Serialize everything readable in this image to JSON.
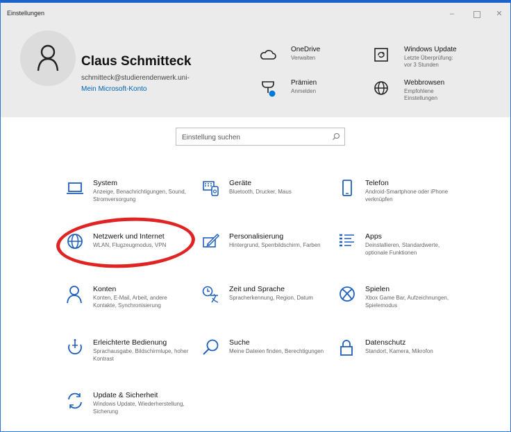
{
  "window": {
    "title": "Einstellungen",
    "controls": {
      "minimize": "–",
      "close": "✕"
    }
  },
  "account": {
    "name": "Claus Schmitteck",
    "email": "schmitteck@studierendenwerk.uni-",
    "link": "Mein Microsoft-Konto"
  },
  "header_items": [
    {
      "title": "OneDrive",
      "sub": [
        "Verwalten"
      ],
      "icon": "cloud-icon"
    },
    {
      "title": "Windows Update",
      "sub": [
        "Letzte Überprüfung:",
        "vor 3 Stunden"
      ],
      "icon": "update-icon"
    },
    {
      "title": "Prämien",
      "sub": [
        "Anmelden"
      ],
      "icon": "trophy-icon"
    },
    {
      "title": "Webbrowsen",
      "sub": [
        "Empfohlene",
        "Einstellungen"
      ],
      "icon": "globe-icon"
    }
  ],
  "search": {
    "placeholder": "Einstellung suchen"
  },
  "tiles": [
    {
      "title": "System",
      "sub": "Anzeige, Benachrichtigungen, Sound, Stromversorgung",
      "icon": "laptop-icon"
    },
    {
      "title": "Geräte",
      "sub": "Bluetooth, Drucker, Maus",
      "icon": "devices-icon"
    },
    {
      "title": "Telefon",
      "sub": "Android-Smartphone oder iPhone verknüpfen",
      "icon": "phone-icon"
    },
    {
      "title": "Netzwerk und Internet",
      "sub": "WLAN, Flugzeugmodus, VPN",
      "icon": "globe-icon"
    },
    {
      "title": "Personalisierung",
      "sub": "Hintergrund, Sperrbildschirm, Farben",
      "icon": "personalize-icon"
    },
    {
      "title": "Apps",
      "sub": "Deinstallieren, Standardwerte, optionale Funktionen",
      "icon": "apps-icon"
    },
    {
      "title": "Konten",
      "sub": "Konten, E-Mail, Arbeit, andere Kontakte, Synchronisierung",
      "icon": "person-icon"
    },
    {
      "title": "Zeit und Sprache",
      "sub": "Spracherkennung, Region, Datum",
      "icon": "time-language-icon"
    },
    {
      "title": "Spielen",
      "sub": "Xbox Game Bar, Aufzeichnungen, Spielemodus",
      "icon": "xbox-icon"
    },
    {
      "title": "Erleichterte Bedienung",
      "sub": "Sprachausgabe, Bildschirmlupe, hoher Kontrast",
      "icon": "accessibility-icon"
    },
    {
      "title": "Suche",
      "sub": "Meine Dateien finden, Berechtigungen",
      "icon": "search-icon"
    },
    {
      "title": "Datenschutz",
      "sub": "Standort, Kamera, Mikrofon",
      "icon": "lock-icon"
    },
    {
      "title": "Update & Sicherheit",
      "sub": "Windows Update, Wiederherstellung, Sicherung",
      "icon": "sync-icon"
    }
  ],
  "colors": {
    "accent": "#0063b1",
    "header_bg": "#ebebeb",
    "highlight": "#e02424",
    "frame": "#2b78d4"
  }
}
